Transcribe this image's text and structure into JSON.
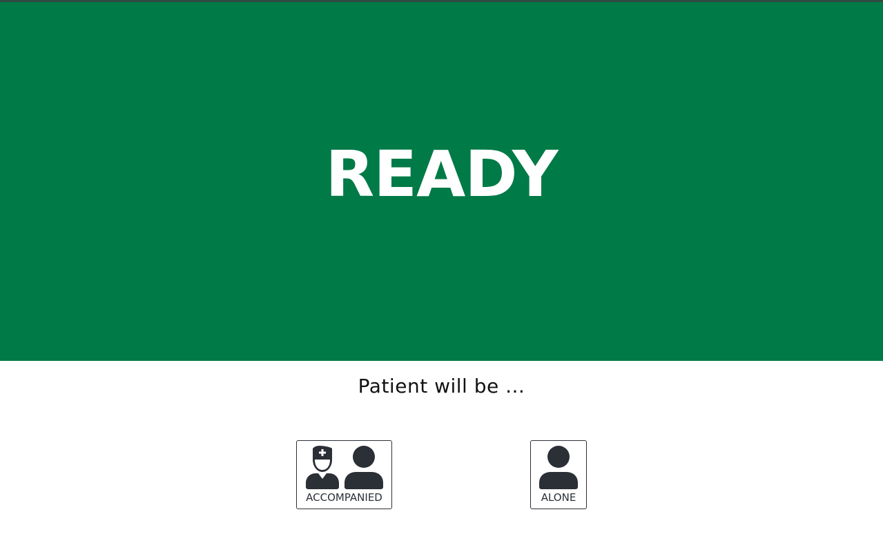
{
  "status": {
    "text": "READY",
    "background_color": "#007a47",
    "text_color": "#ffffff"
  },
  "prompt": {
    "text": "Patient will be ..."
  },
  "choices": [
    {
      "label": "ACCOMPANIED",
      "icons": [
        "nurse-icon",
        "person-icon"
      ]
    },
    {
      "label": "ALONE",
      "icons": [
        "person-icon"
      ]
    }
  ],
  "colors": {
    "icon": "#2b2f36",
    "border": "#2b2f36"
  }
}
